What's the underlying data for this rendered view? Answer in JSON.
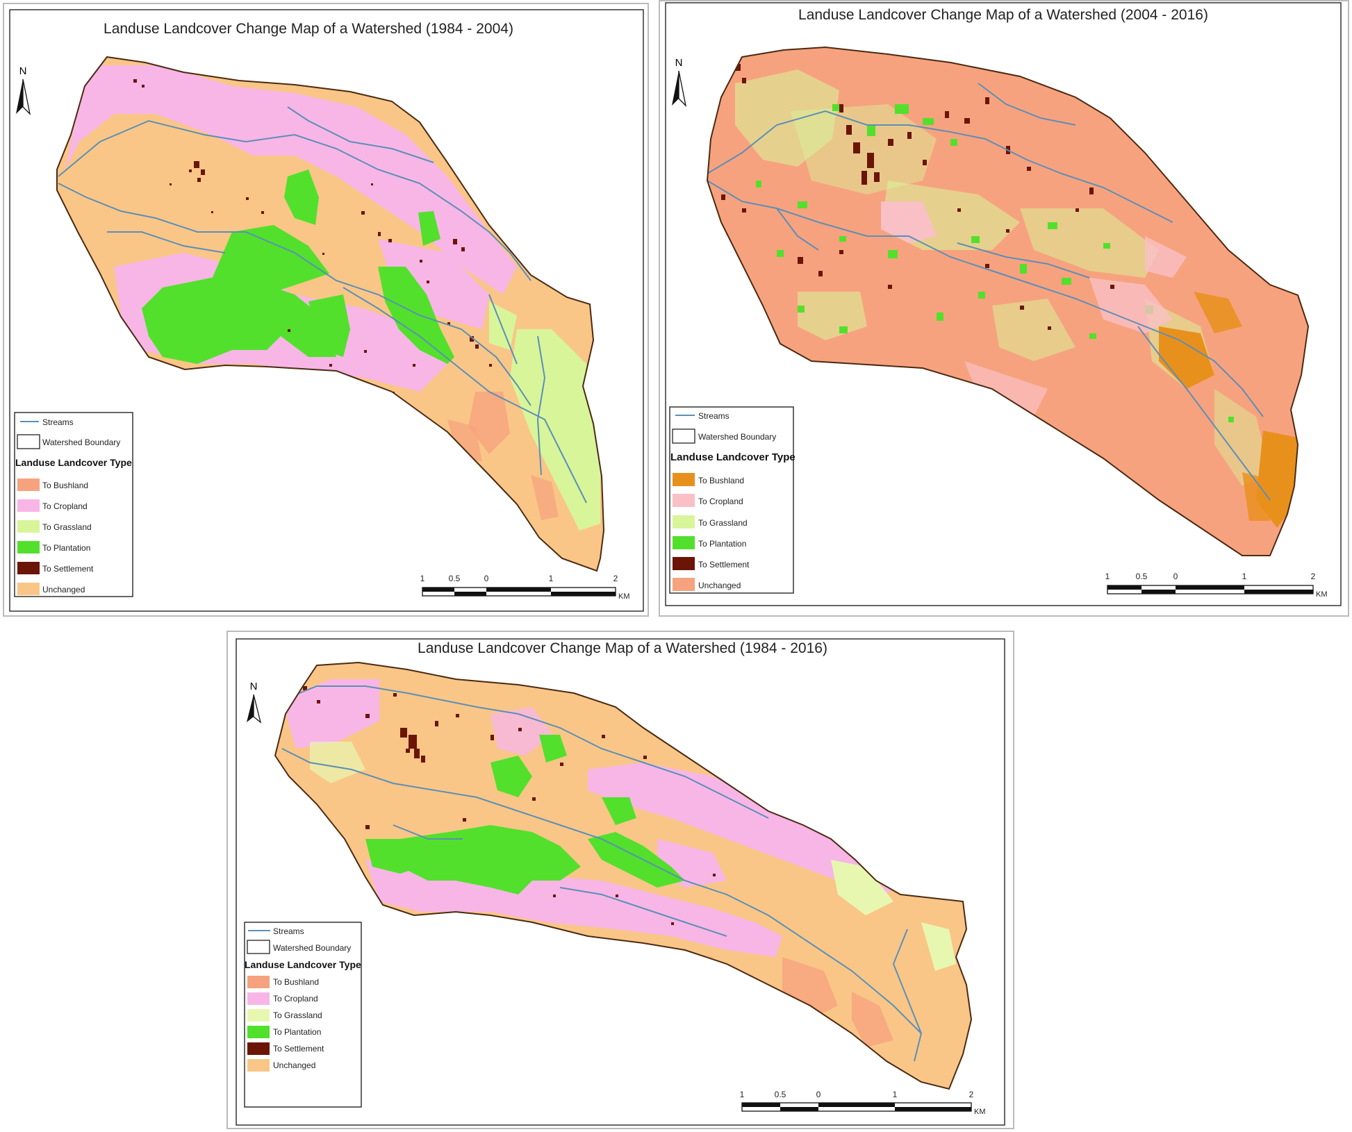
{
  "colors": {
    "bushland_a": "#f7a27e",
    "bushland_b": "#e8901c",
    "cropland_a": "#f7b6e6",
    "cropland_b": "#f9c0c6",
    "grassland": "#d8f59a",
    "plantation": "#52e02c",
    "settlement": "#6b1506",
    "unchanged_a": "#f9c687",
    "unchanged_b": "#f7a27e",
    "stream": "#5b8fb8",
    "boundary": "#4a2a12"
  },
  "maps": [
    {
      "title": "Landuse Landcover Change Map of a Watershed (1984 - 2004)",
      "north": "N",
      "legend": {
        "streams": "Streams",
        "boundary": "Watershed Boundary",
        "heading": "Landuse Landcover Type",
        "classes": [
          {
            "label": "To Bushland",
            "color": "#f7a27e"
          },
          {
            "label": "To Cropland",
            "color": "#f7b6e6"
          },
          {
            "label": "To Grassland",
            "color": "#d8f59a"
          },
          {
            "label": "To Plantation",
            "color": "#52e02c"
          },
          {
            "label": "To Settlement",
            "color": "#6b1506"
          },
          {
            "label": "Unchanged",
            "color": "#f9c687"
          }
        ]
      },
      "scale": {
        "ticks": [
          "1",
          "0.5",
          "0",
          "1",
          "2"
        ],
        "unit": "KM"
      }
    },
    {
      "title": "Landuse Landcover Change Map of a Watershed (2004 - 2016)",
      "north": "N",
      "legend": {
        "streams": "Streams",
        "boundary": "Watershed Boundary",
        "heading": "Landuse Landcover Type",
        "classes": [
          {
            "label": "To Bushland",
            "color": "#e8901c"
          },
          {
            "label": "To Cropland",
            "color": "#f9c0c6"
          },
          {
            "label": "To Grassland",
            "color": "#d8f59a"
          },
          {
            "label": "To Plantation",
            "color": "#52e02c"
          },
          {
            "label": "To Settlement",
            "color": "#6b1506"
          },
          {
            "label": "Unchanged",
            "color": "#f7a27e"
          }
        ]
      },
      "scale": {
        "ticks": [
          "1",
          "0.5",
          "0",
          "1",
          "2"
        ],
        "unit": "KM"
      }
    },
    {
      "title": "Landuse Landcover Change Map of a Watershed (1984 - 2016)",
      "north": "N",
      "legend": {
        "streams": "Streams",
        "boundary": "Watershed Boundary",
        "heading": "Landuse Landcover Type",
        "classes": [
          {
            "label": "To Bushland",
            "color": "#f7a27e"
          },
          {
            "label": "To Cropland",
            "color": "#f7b6e6"
          },
          {
            "label": "To Grassland",
            "color": "#e8f7b0"
          },
          {
            "label": "To Plantation",
            "color": "#52e02c"
          },
          {
            "label": "To Settlement",
            "color": "#6b1506"
          },
          {
            "label": "Unchanged",
            "color": "#f9c687"
          }
        ]
      },
      "scale": {
        "ticks": [
          "1",
          "0.5",
          "0",
          "1",
          "2"
        ],
        "unit": "KM"
      }
    }
  ]
}
